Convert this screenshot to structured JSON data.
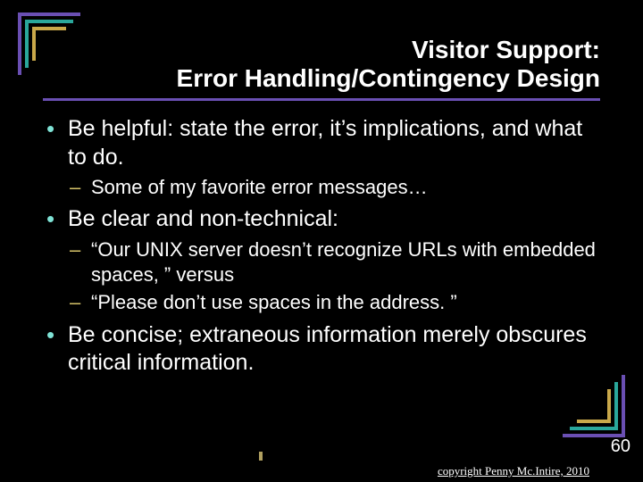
{
  "title_line1": "Visitor Support:",
  "title_line2": "Error Handling/Contingency Design",
  "bullets": [
    {
      "text": "Be helpful: state the error, it’s implications, and what to do.",
      "sub": [
        "Some of my favorite error messages…"
      ]
    },
    {
      "text": "Be clear and non-technical:",
      "sub": [
        "“Our UNIX server doesn’t recognize URLs with embedded spaces, ” versus",
        "“Please don’t use spaces in the address. ”"
      ]
    },
    {
      "text": "Be concise; extraneous information merely obscures critical information.",
      "sub": []
    }
  ],
  "slide_number": "60",
  "copyright": "copyright Penny Mc.Intire, 2010"
}
